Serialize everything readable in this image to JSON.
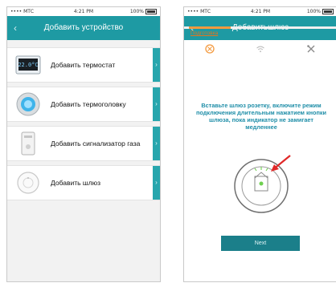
{
  "left_screen": {
    "status": {
      "carrier": "•••• МТС",
      "time": "4:21 PM",
      "battery": "100%"
    },
    "nav": {
      "back_icon": "chevron-left-icon",
      "title": "Добавить устройство"
    },
    "items": [
      {
        "label": "Добавить термостат",
        "icon": "thermostat-icon",
        "thumb_text": "22.0°C"
      },
      {
        "label": "Добавить термоголовку",
        "icon": "thermostatic-head-icon"
      },
      {
        "label": "Добавить сигнализатор газа",
        "icon": "gas-detector-icon"
      },
      {
        "label": "Добавить шлюз",
        "icon": "gateway-icon"
      }
    ]
  },
  "right_screen": {
    "status": {
      "carrier": "•••• МТС",
      "time": "4:21 PM",
      "battery": "100%"
    },
    "nav": {
      "back_icon": "chevron-left-icon",
      "title": "Добавитьшлюз"
    },
    "steps": [
      {
        "icon": "settings-circle-icon",
        "active": true
      },
      {
        "icon": "wifi-icon",
        "active": false
      },
      {
        "icon": "tools-icon",
        "active": false
      }
    ],
    "step_label": "Подготовка",
    "instruction": "Вставьте шлюз розетку, включите режим подключения длительным нажатием кнопки шлюза, пока индикатор не замигает медленнее",
    "next_button": "Next"
  },
  "colors": {
    "accent": "#1e9aa3",
    "arrow_tab": "#27a6ad",
    "step_active": "#f39a3e",
    "instruction_text": "#1f8ea8",
    "next_button": "#1b7f8a",
    "pointer_arrow": "#e02828"
  }
}
